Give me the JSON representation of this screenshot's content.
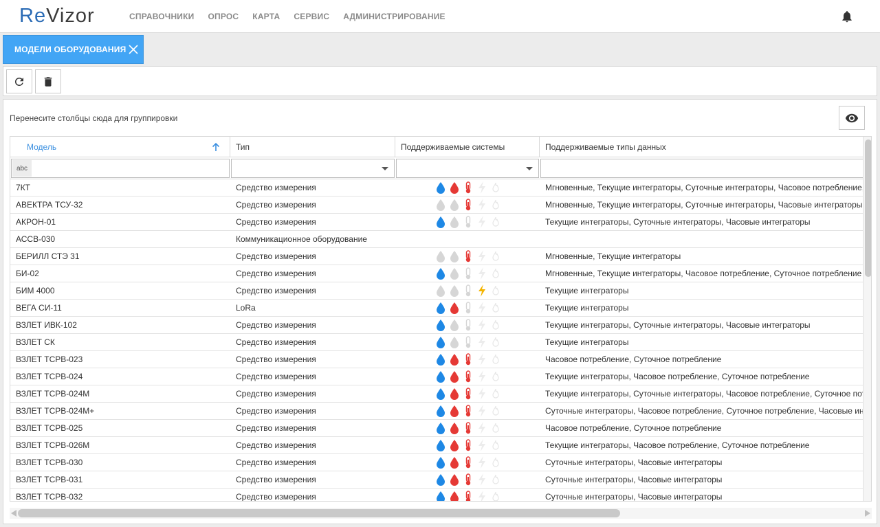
{
  "app": {
    "logo_re": "Re",
    "logo_vizor": "Vizor"
  },
  "nav": {
    "items": [
      "СПРАВОЧНИКИ",
      "ОПРОС",
      "КАРТА",
      "СЕРВИС",
      "АДМИНИСТРИРОВАНИЕ"
    ]
  },
  "tab": {
    "label": "МОДЕЛИ ОБОРУДОВАНИЯ"
  },
  "toolbar": {
    "refresh_icon": "refresh-icon",
    "delete_icon": "trash-icon"
  },
  "grid": {
    "group_hint": "Перенесите столбцы сюда для группировки",
    "columns": [
      "Модель",
      "Тип",
      "Поддерживаемые системы",
      "Поддерживаемые типы данных"
    ],
    "filter_abc": "abc",
    "system_colors": {
      "cold_water": "#1e88e5",
      "hot_water": "#e53935",
      "heat": "#e53935",
      "electricity": "#f4b400",
      "gas": "#cccccc",
      "inactive": "#d6d6d6"
    },
    "rows": [
      {
        "model": "7КТ",
        "type": "Средство измерения",
        "sys": [
          1,
          1,
          1,
          0,
          0
        ],
        "data": "Мгновенные, Текущие интеграторы, Суточные интеграторы, Часовое потребление, Суточное потребление"
      },
      {
        "model": "АВЕКТРА ТСУ-32",
        "type": "Средство измерения",
        "sys": [
          0,
          0,
          1,
          0,
          0
        ],
        "data": "Мгновенные, Текущие интеграторы, Суточные интеграторы, Часовые интеграторы"
      },
      {
        "model": "АКРОН-01",
        "type": "Средство измерения",
        "sys": [
          1,
          0,
          0,
          0,
          0
        ],
        "data": "Текущие интеграторы, Суточные интеграторы, Часовые интеграторы"
      },
      {
        "model": "АССВ-030",
        "type": "Коммуникационное оборудование",
        "sys": null,
        "data": ""
      },
      {
        "model": "БЕРИЛЛ СТЭ 31",
        "type": "Средство измерения",
        "sys": [
          0,
          0,
          1,
          0,
          0
        ],
        "data": "Мгновенные, Текущие интеграторы"
      },
      {
        "model": "БИ-02",
        "type": "Средство измерения",
        "sys": [
          1,
          0,
          0,
          0,
          0
        ],
        "data": "Мгновенные, Текущие интеграторы, Часовое потребление, Суточное потребление"
      },
      {
        "model": "БИМ 4000",
        "type": "Средство измерения",
        "sys": [
          0,
          0,
          0,
          1,
          0
        ],
        "data": "Текущие интеграторы"
      },
      {
        "model": "ВЕГА СИ-11",
        "type": "LoRa",
        "sys": [
          1,
          1,
          0,
          0,
          0
        ],
        "data": "Текущие интеграторы"
      },
      {
        "model": "ВЗЛЕТ ИВК-102",
        "type": "Средство измерения",
        "sys": [
          1,
          0,
          0,
          0,
          0
        ],
        "data": "Текущие интеграторы, Суточные интеграторы, Часовые интеграторы"
      },
      {
        "model": "ВЗЛЕТ СК",
        "type": "Средство измерения",
        "sys": [
          1,
          0,
          0,
          0,
          0
        ],
        "data": "Текущие интеграторы"
      },
      {
        "model": "ВЗЛЕТ ТСРВ-023",
        "type": "Средство измерения",
        "sys": [
          1,
          1,
          1,
          0,
          0
        ],
        "data": "Часовое потребление, Суточное потребление"
      },
      {
        "model": "ВЗЛЕТ ТСРВ-024",
        "type": "Средство измерения",
        "sys": [
          1,
          1,
          1,
          0,
          0
        ],
        "data": "Текущие интеграторы, Часовое потребление, Суточное потребление"
      },
      {
        "model": "ВЗЛЕТ ТСРВ-024М",
        "type": "Средство измерения",
        "sys": [
          1,
          1,
          1,
          0,
          0
        ],
        "data": "Текущие интеграторы, Суточные интеграторы, Часовое потребление, Суточное потребление"
      },
      {
        "model": "ВЗЛЕТ ТСРВ-024М+",
        "type": "Средство измерения",
        "sys": [
          1,
          1,
          1,
          0,
          0
        ],
        "data": "Суточные интеграторы, Часовое потребление, Суточное потребление, Часовые интеграторы"
      },
      {
        "model": "ВЗЛЕТ ТСРВ-025",
        "type": "Средство измерения",
        "sys": [
          1,
          1,
          1,
          0,
          0
        ],
        "data": "Часовое потребление, Суточное потребление"
      },
      {
        "model": "ВЗЛЕТ ТСРВ-026М",
        "type": "Средство измерения",
        "sys": [
          1,
          1,
          1,
          0,
          0
        ],
        "data": "Текущие интеграторы, Часовое потребление, Суточное потребление"
      },
      {
        "model": "ВЗЛЕТ ТСРВ-030",
        "type": "Средство измерения",
        "sys": [
          1,
          1,
          1,
          0,
          0
        ],
        "data": "Суточные интеграторы, Часовые интеграторы"
      },
      {
        "model": "ВЗЛЕТ ТСРВ-031",
        "type": "Средство измерения",
        "sys": [
          1,
          1,
          1,
          0,
          0
        ],
        "data": "Суточные интеграторы, Часовые интеграторы"
      },
      {
        "model": "ВЗЛЕТ ТСРВ-032",
        "type": "Средство измерения",
        "sys": [
          1,
          1,
          1,
          0,
          0
        ],
        "data": "Суточные интеграторы, Часовые интеграторы"
      }
    ]
  }
}
